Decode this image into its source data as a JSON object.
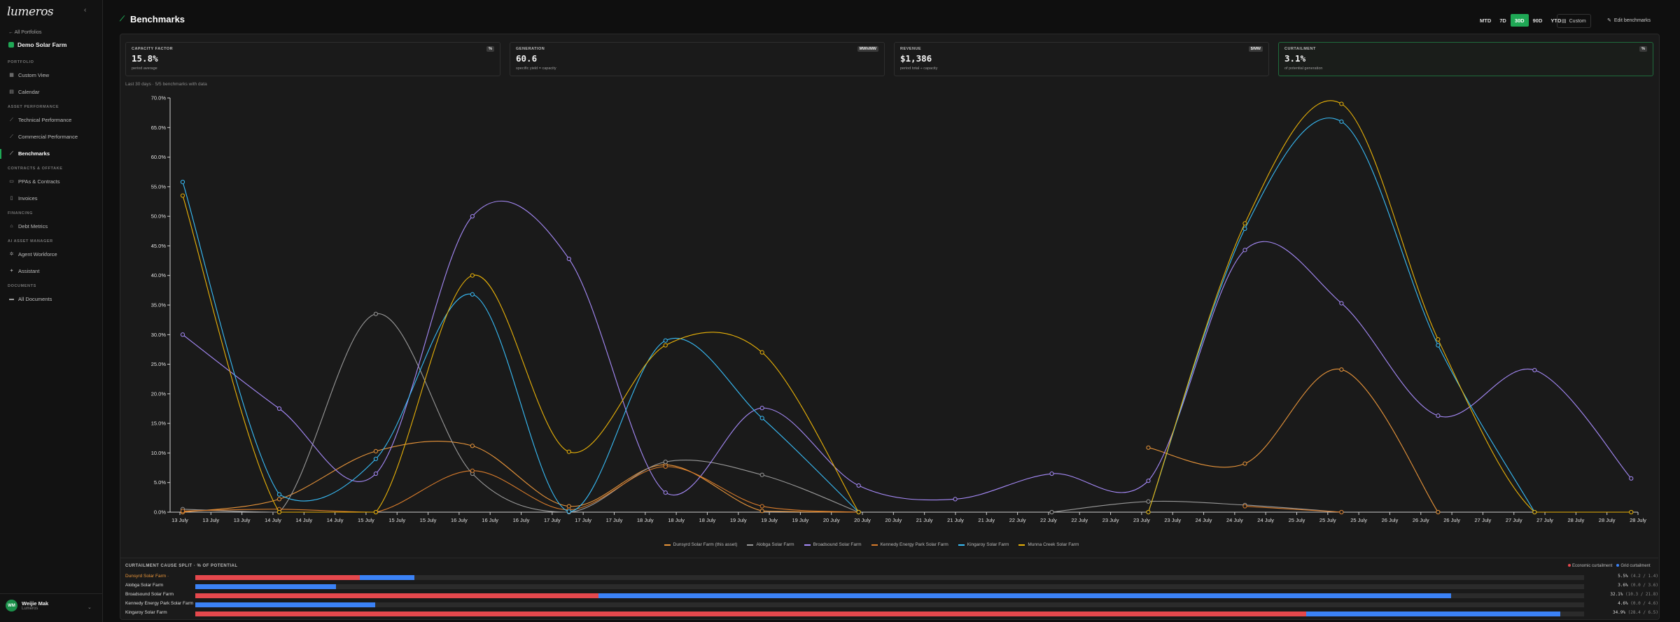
{
  "sidebar": {
    "logo": "lumeros",
    "back": "All Portfolios",
    "farm": "Demo Solar Farm",
    "sections": {
      "portfolio": "PORTFOLIO",
      "asset": "ASSET PERFORMANCE",
      "contracts": "CONTRACTS & OFFTAKE",
      "financing": "FINANCING",
      "ai": "AI ASSET MANAGER",
      "documents": "DOCUMENTS"
    },
    "items": {
      "custom_view": "Custom View",
      "calendar": "Calendar",
      "technical": "Technical Performance",
      "commercial": "Commercial Performance",
      "benchmarks": "Benchmarks",
      "ppas": "PPAs & Contracts",
      "invoices": "Invoices",
      "debt": "Debt Metrics",
      "agent": "Agent Workforce",
      "assistant": "Assistant",
      "all_docs": "All Documents"
    },
    "user": {
      "initials": "WM",
      "name": "Weijie Mak",
      "org": "Lumeros"
    }
  },
  "header": {
    "title": "Benchmarks",
    "ranges": [
      "MTD",
      "7D",
      "30D",
      "90D",
      "YTD"
    ],
    "selected_range": "30D",
    "custom": "Custom",
    "edit": "Edit benchmarks"
  },
  "kpis": [
    {
      "label": "CAPACITY FACTOR",
      "unit": "%",
      "value": "15.8%",
      "sub": "period average",
      "selected": false
    },
    {
      "label": "GENERATION",
      "unit": "MWh/MW",
      "value": "60.6",
      "sub": "specific yield = capacity",
      "selected": false
    },
    {
      "label": "REVENUE",
      "unit": "$/MW",
      "value": "$1,386",
      "sub": "period total ÷ capacity",
      "selected": false
    },
    {
      "label": "CURTAILMENT",
      "unit": "%",
      "value": "3.1%",
      "sub": "of potential generation",
      "selected": true
    }
  ],
  "note": "Last 30 days · 5/5 benchmarks with data",
  "chart_data": {
    "type": "line",
    "ylim": [
      0,
      70
    ],
    "yticks": [
      "0.0%",
      "5.0%",
      "10.0%",
      "15.0%",
      "20.0%",
      "25.0%",
      "30.0%",
      "35.0%",
      "40.0%",
      "45.0%",
      "50.0%",
      "55.0%",
      "60.0%",
      "65.0%",
      "70.0%"
    ],
    "xticks": [
      "13 July",
      "13 July",
      "13 July",
      "14 July",
      "14 July",
      "14 July",
      "15 July",
      "15 July",
      "15 July",
      "16 July",
      "16 July",
      "16 July",
      "17 July",
      "17 July",
      "17 July",
      "18 July",
      "18 July",
      "18 July",
      "19 July",
      "19 July",
      "19 July",
      "20 July",
      "20 July",
      "20 July",
      "21 July",
      "21 July",
      "21 July",
      "22 July",
      "22 July",
      "22 July",
      "23 July",
      "23 July",
      "23 July",
      "24 July",
      "24 July",
      "24 July",
      "25 July",
      "25 July",
      "25 July",
      "26 July",
      "26 July",
      "26 July",
      "27 July",
      "27 July",
      "27 July",
      "28 July",
      "28 July",
      "28 July"
    ],
    "x": [
      "13 July",
      "14 July",
      "15 July",
      "16 July",
      "17 July",
      "18 July",
      "19 July",
      "20 July",
      "21 July",
      "22 July",
      "23 July",
      "24 July",
      "25 July",
      "26 July",
      "27 July",
      "28 July"
    ],
    "series": [
      {
        "name": "Dunsyrd Solar Farm (this asset)",
        "color": "#e9953a",
        "values": [
          0,
          2.2,
          10.3,
          11.2,
          1.0,
          8.0,
          0.2,
          0,
          null,
          null,
          10.9,
          8.2,
          24.1,
          0,
          null,
          null
        ]
      },
      {
        "name": "Alobga Solar Farm",
        "color": "#9a9a9a",
        "values": [
          0.5,
          0,
          33.5,
          6.5,
          0,
          8.5,
          6.3,
          0,
          null,
          0,
          1.8,
          1.2,
          0,
          null,
          null,
          null
        ]
      },
      {
        "name": "Broadsound Solar Farm",
        "color": "#a78bfa",
        "values": [
          30.0,
          17.5,
          6.5,
          50.0,
          42.8,
          3.3,
          17.6,
          4.5,
          2.2,
          6.5,
          5.3,
          44.3,
          35.3,
          16.3,
          24.0,
          5.7
        ]
      },
      {
        "name": "Kennedy Energy Park Solar Farm",
        "color": "#d97c2b",
        "values": [
          0.2,
          0.5,
          0,
          7.0,
          0.4,
          7.7,
          1.0,
          0,
          null,
          null,
          null,
          1.0,
          0,
          null,
          null,
          null
        ]
      },
      {
        "name": "Kingaroy Solar Farm",
        "color": "#38bdf8",
        "values": [
          55.8,
          3.0,
          9.0,
          36.8,
          0.1,
          29.0,
          15.9,
          0,
          null,
          null,
          0,
          47.9,
          66.0,
          28.2,
          0,
          null
        ]
      },
      {
        "name": "Munna Creek Solar Farm",
        "color": "#eab308",
        "values": [
          53.5,
          0,
          0,
          40.0,
          10.2,
          28.2,
          27.0,
          0,
          null,
          null,
          0,
          48.8,
          69.0,
          29.2,
          0,
          0
        ]
      }
    ]
  },
  "split": {
    "title": "CURTAILMENT CAUSE SPLIT · % OF POTENTIAL",
    "legend_economic": "Economic curtailment",
    "legend_grid": "Grid curtailment",
    "max": 35.5,
    "rows": [
      {
        "name": "Dunsyrd Solar Farm ·",
        "own": true,
        "economic": 4.2,
        "grid": 1.4,
        "total": "5.5%",
        "detail": "(4.2 / 1.4)"
      },
      {
        "name": "Alobga Solar Farm",
        "own": false,
        "economic": 0.0,
        "grid": 3.6,
        "total": "3.6%",
        "detail": "(0.0 / 3.6)"
      },
      {
        "name": "Broadsound Solar Farm",
        "own": false,
        "economic": 10.3,
        "grid": 21.8,
        "total": "32.1%",
        "detail": "(10.3 / 21.8)"
      },
      {
        "name": "Kennedy Energy Park Solar Farm",
        "own": false,
        "economic": 0.0,
        "grid": 4.6,
        "total": "4.6%",
        "detail": "(0.0 / 4.6)"
      },
      {
        "name": "Kingaroy Solar Farm",
        "own": false,
        "economic": 28.4,
        "grid": 6.5,
        "total": "34.9%",
        "detail": "(28.4 / 6.5)"
      }
    ]
  }
}
